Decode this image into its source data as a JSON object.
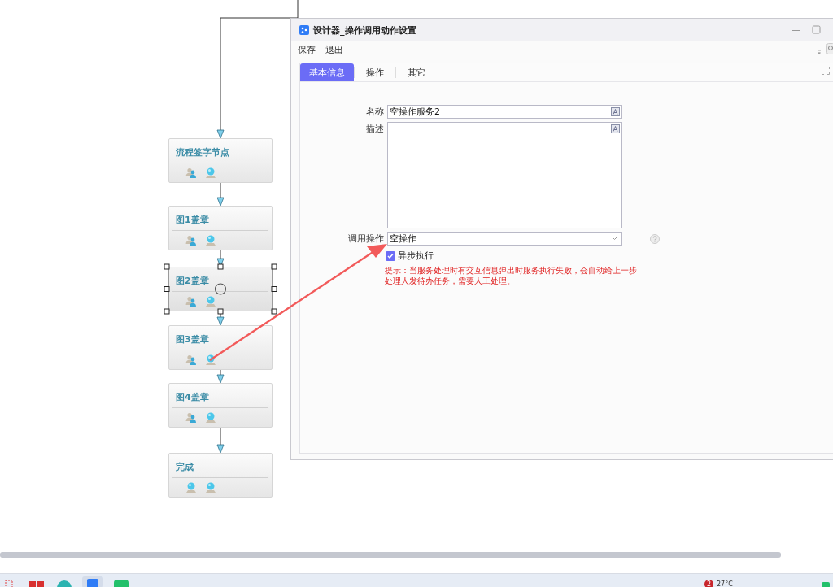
{
  "flow": {
    "nodes": [
      {
        "title": "流程签字节点",
        "selected": false,
        "icons": [
          {
            "kind": "users"
          },
          {
            "kind": "monitor"
          }
        ]
      },
      {
        "title": "图1盖章",
        "selected": false,
        "icons": [
          {
            "kind": "users"
          },
          {
            "kind": "monitor"
          }
        ]
      },
      {
        "title": "图2盖章",
        "selected": true,
        "icons": [
          {
            "kind": "users"
          },
          {
            "kind": "monitor"
          }
        ]
      },
      {
        "title": "图3盖章",
        "selected": false,
        "icons": [
          {
            "kind": "users"
          },
          {
            "kind": "monitor"
          }
        ]
      },
      {
        "title": "图4盖章",
        "selected": false,
        "icons": [
          {
            "kind": "users"
          },
          {
            "kind": "monitor"
          }
        ]
      },
      {
        "title": "完成",
        "selected": false,
        "icons": [
          {
            "kind": "monitor"
          },
          {
            "kind": "monitor"
          }
        ]
      }
    ]
  },
  "dialog": {
    "title": "设计器_操作调用动作设置",
    "menu": [
      "保存",
      "退出"
    ],
    "tabs": [
      {
        "label": "基本信息",
        "selected": true
      },
      {
        "label": "操作",
        "selected": false
      },
      {
        "label": "其它",
        "selected": false
      }
    ],
    "form": {
      "name_label": "名称",
      "name_value": "空操作服务2",
      "description_label": "描述",
      "operation_label": "调用操作",
      "operation_value": "空操作",
      "async": {
        "label": "异步执行",
        "checked": true
      },
      "hint": "提示：当服务处理时有交互信息弹出时服务执行失败，会自动给上一步处理人发待办任务，需要人工处理。"
    }
  },
  "taskbar": {
    "badge": "2",
    "temperature": "27°C"
  }
}
